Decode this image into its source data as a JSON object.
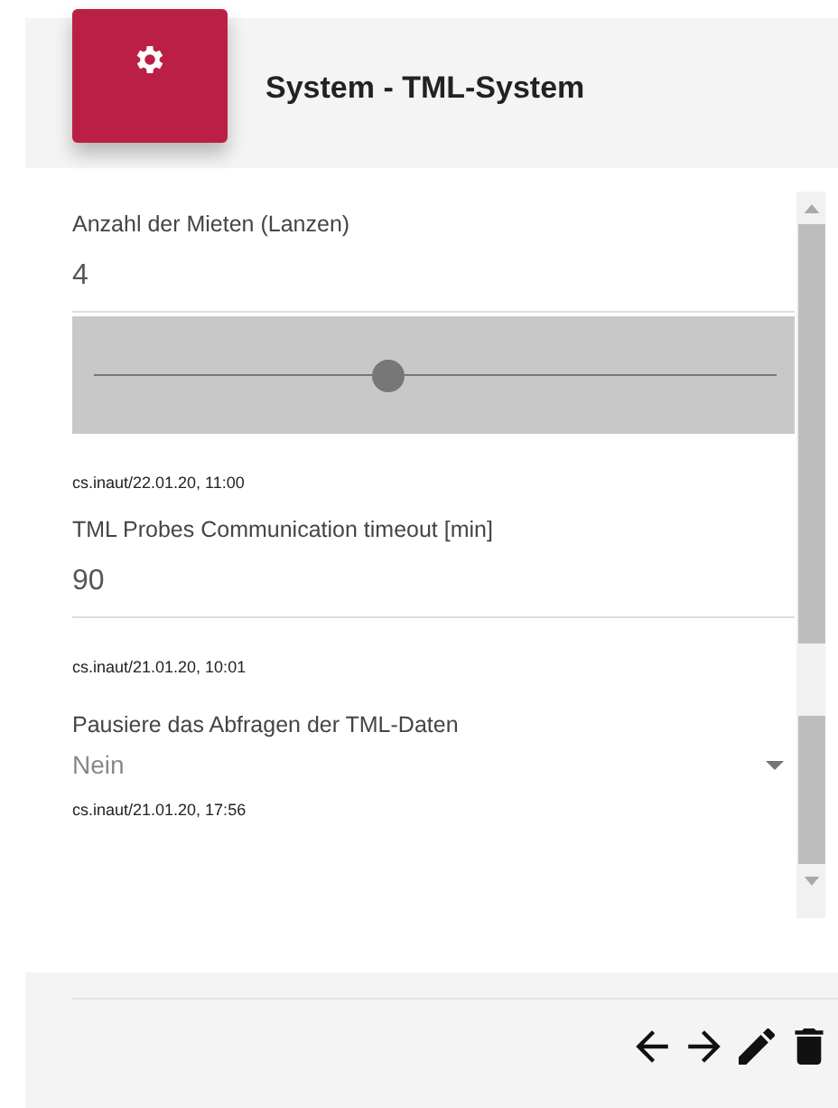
{
  "header": {
    "title": "System - TML-System"
  },
  "fields": [
    {
      "kind": "number",
      "label": "Anzahl der Mieten (Lanzen)",
      "value": "4"
    },
    {
      "kind": "slider",
      "level": 0.43
    },
    {
      "kind": "meta",
      "text": "cs.inaut/22.01.20, 11:00"
    },
    {
      "kind": "number",
      "label": "TML Probes Communication timeout [min]",
      "value": "90"
    },
    {
      "kind": "meta",
      "text": "cs.inaut/21.01.20, 10:01"
    },
    {
      "kind": "select",
      "label": "Pausiere das Abfragen der TML-Daten",
      "value": "Nein"
    },
    {
      "kind": "meta",
      "text": "cs.inaut/21.01.20, 17:56"
    }
  ],
  "actions": [
    {
      "kind": "back"
    },
    {
      "kind": "forward"
    },
    {
      "kind": "edit"
    },
    {
      "kind": "delete"
    }
  ]
}
